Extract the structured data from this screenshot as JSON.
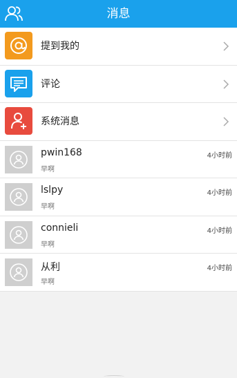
{
  "header": {
    "title": "消息",
    "left_icon": "contacts-icon"
  },
  "menu_items": [
    {
      "label": "提到我的",
      "icon": "at-icon",
      "color": "#f39a1e"
    },
    {
      "label": "评论",
      "icon": "comment-icon",
      "color": "#1aa1ec"
    },
    {
      "label": "系统消息",
      "icon": "person-add-icon",
      "color": "#e84b3e"
    }
  ],
  "conversations": [
    {
      "name": "pwin168",
      "preview": "早啊",
      "time": "4小时前"
    },
    {
      "name": "lslpy",
      "preview": "早啊",
      "time": "4小时前"
    },
    {
      "name": "connieli",
      "preview": "早啊",
      "time": "4小时前"
    },
    {
      "name": "从利",
      "preview": "早啊",
      "time": "4小时前"
    }
  ],
  "colors": {
    "header_bg": "#1aa1ec",
    "page_bg": "#f2f2f2"
  }
}
